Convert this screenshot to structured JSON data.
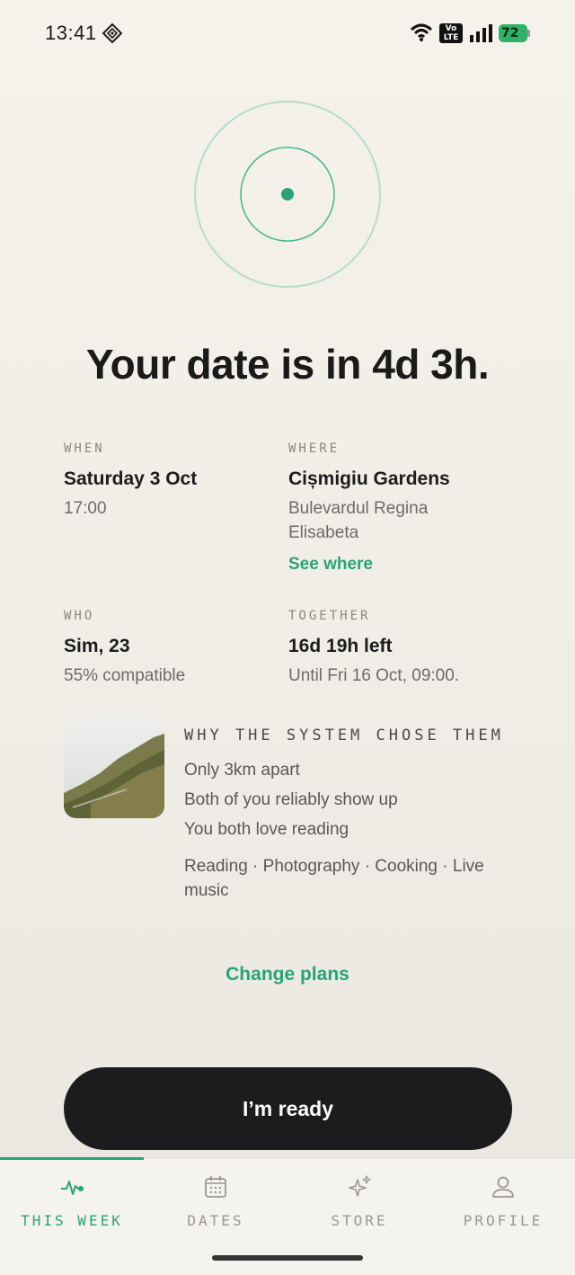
{
  "status_bar": {
    "time": "13:41",
    "volte": "Vo LTE",
    "battery": "72"
  },
  "headline": "Your date is in 4d 3h.",
  "details": {
    "when": {
      "label": "WHEN",
      "value": "Saturday 3 Oct",
      "sub": "17:00"
    },
    "where": {
      "label": "WHERE",
      "value": "Cișmigiu Gardens",
      "address_line1": "Bulevardul Regina",
      "address_line2": "Elisabeta",
      "link": "See where"
    },
    "who": {
      "label": "WHO",
      "value": "Sim, 23",
      "sub": "55% compatible"
    },
    "together": {
      "label": "TOGETHER",
      "value": "16d 19h left",
      "sub": "Until Fri 16 Oct, 09:00."
    }
  },
  "why": {
    "title": "WHY THE SYSTEM CHOSE THEM",
    "reasons": [
      "Only 3km apart",
      "Both of you reliably show up",
      "You both love reading"
    ],
    "interests": "Reading · Photography · Cooking · Live music"
  },
  "change_plans": "Change plans",
  "ready_button": "I’m ready",
  "nav": [
    {
      "label": "THIS WEEK",
      "icon": "pulse-icon",
      "active": true
    },
    {
      "label": "DATES",
      "icon": "calendar-icon",
      "active": false
    },
    {
      "label": "STORE",
      "icon": "sparkles-icon",
      "active": false
    },
    {
      "label": "PROFILE",
      "icon": "person-icon",
      "active": false
    }
  ],
  "colors": {
    "accent": "#2aa37a",
    "button": "#1c1c1e",
    "background": "#f2f0e8"
  }
}
